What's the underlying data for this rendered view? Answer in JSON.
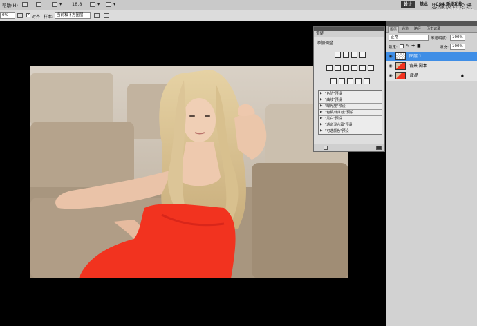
{
  "appbar": {
    "help": "帮助(H)",
    "zoom": "18.8",
    "workspaces": [
      "设计",
      "基本",
      "CS4 新增功能"
    ],
    "more": "≫",
    "watermark_cn": "思缘设计论坛",
    "watermark_url": "www.MISSYUAN.com"
  },
  "options": {
    "zoom_field": "0%",
    "align_label": "对齐",
    "sample_label": "样本:",
    "sample_value": "当前和下方图层"
  },
  "adjustments": {
    "tab": "调整",
    "title": "添加调整",
    "presets": [
      "\"色阶\"预设",
      "\"曲线\"预设",
      "\"曝光度\"预设",
      "\"色相/饱和度\"预设",
      "\"黑白\"预设",
      "\"通道混合器\"预设",
      "\"可选颜色\"预设"
    ]
  },
  "layers_panel": {
    "tabs": [
      "图层",
      "通道",
      "路径",
      "历史记录"
    ],
    "blend_mode": "正常",
    "opacity_label": "不透明度:",
    "opacity_value": "100%",
    "lock_label": "锁定:",
    "fill_label": "填充:",
    "fill_value": "100%",
    "layers": [
      {
        "name": "图层 1",
        "selected": true
      },
      {
        "name": "背景 副本",
        "selected": false
      },
      {
        "name": "背景",
        "selected": false
      }
    ]
  },
  "colors": {
    "accent": "#3f8ee6",
    "dress": "#f2331f"
  }
}
